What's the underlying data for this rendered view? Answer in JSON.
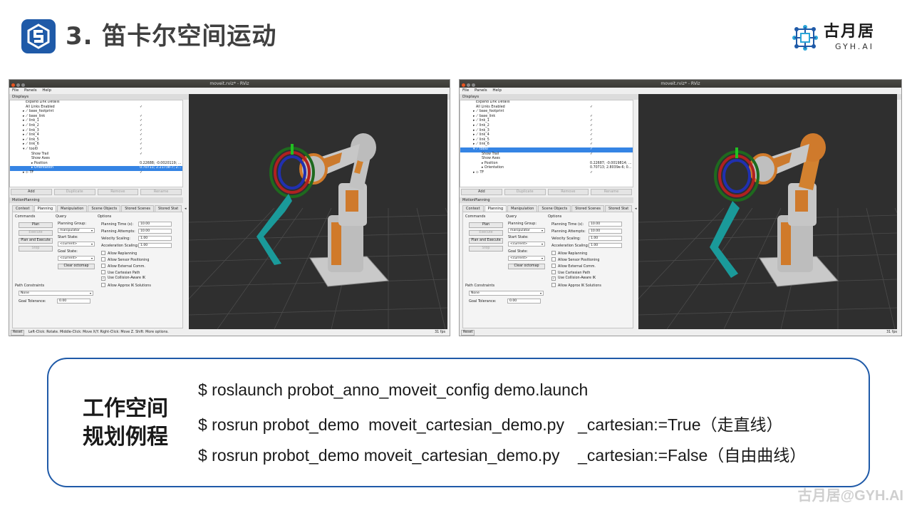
{
  "slide": {
    "title": "3. 笛卡尔空间运动",
    "brand_name": "古月居",
    "brand_sub": "GYH.AI",
    "accent": "#1f5aa8",
    "watermark": "古月居@GYH.AI"
  },
  "rviz_left": {
    "window_title": "moveit.rviz* - RViz",
    "menu": [
      "File",
      "Panels",
      "Help"
    ],
    "displays_header": "Displays",
    "tree": [
      {
        "label": "Expand Link Details",
        "check": ""
      },
      {
        "label": "All Links Enabled",
        "check": "✓"
      },
      {
        "label": "▸ ⟋ base_footprint",
        "check": ""
      },
      {
        "label": "▸ ⟋ base_link",
        "check": "✓"
      },
      {
        "label": "▸ ⟋ link_1",
        "check": "✓"
      },
      {
        "label": "▸ ⟋ link_2",
        "check": "✓"
      },
      {
        "label": "▸ ⟋ link_3",
        "check": "✓"
      },
      {
        "label": "▸ ⟋ link_4",
        "check": "✓"
      },
      {
        "label": "▸ ⟋ link_5",
        "check": "✓"
      },
      {
        "label": "▸ ⟋ link_6",
        "check": "✓"
      },
      {
        "label": "▾ ⟋ tool0",
        "check": "✓"
      },
      {
        "label": "Show Trail",
        "check": "✓"
      },
      {
        "label": "Show Axes",
        "check": ""
      },
      {
        "label": "▸ Position",
        "check": "0.22688; -0.0020119; ..."
      },
      {
        "label": "▸ Orientation",
        "check": "0.70711; 2.2173e-7; 2..."
      },
      {
        "label": "▸ ⊹ TF",
        "check": "✓"
      }
    ],
    "selected_row": 14,
    "status": "Left-Click: Rotate. Middle-Click: Move X/Y. Right-Click: Move Z. Shift: More options.",
    "fps": "31 fps"
  },
  "rviz_right": {
    "window_title": "moveit.rviz* - RViz",
    "menu": [
      "File",
      "Panels",
      "Help"
    ],
    "displays_header": "Displays",
    "tree": [
      {
        "label": "Expand Link Details",
        "check": ""
      },
      {
        "label": "All Links Enabled",
        "check": "✓"
      },
      {
        "label": "▸ ⟋ base_footprint",
        "check": ""
      },
      {
        "label": "▸ ⟋ base_link",
        "check": "✓"
      },
      {
        "label": "▸ ⟋ link_1",
        "check": "✓"
      },
      {
        "label": "▸ ⟋ link_2",
        "check": "✓"
      },
      {
        "label": "▸ ⟋ link_3",
        "check": "✓"
      },
      {
        "label": "▸ ⟋ link_4",
        "check": "✓"
      },
      {
        "label": "▸ ⟋ link_5",
        "check": "✓"
      },
      {
        "label": "▸ ⟋ link_6",
        "check": "✓"
      },
      {
        "label": "▾ ⟋ tool0",
        "check": "✓"
      },
      {
        "label": "Show Trail",
        "check": "✓"
      },
      {
        "label": "Show Axes",
        "check": ""
      },
      {
        "label": "▸ Position",
        "check": "0.22687; -0.0019814; ..."
      },
      {
        "label": "▸ Orientation",
        "check": "0.70713; 2.8039e-6; 0..."
      },
      {
        "label": "▸ ⊹ TF",
        "check": "✓"
      }
    ],
    "selected_row": 10,
    "status": "",
    "fps": "31 fps"
  },
  "buttons": {
    "add": "Add",
    "duplicate": "Duplicate",
    "remove": "Remove",
    "rename": "Rename"
  },
  "motion_planning": {
    "header": "MotionPlanning",
    "tabs": [
      "Context",
      "Planning",
      "Manipulation",
      "Scene Objects",
      "Stored Scenes",
      "Stored Stat"
    ],
    "commands": "Commands",
    "query": "Query",
    "options": "Options",
    "plan": "Plan",
    "execute": "Execute",
    "plan_execute": "Plan and Execute",
    "stop": "Stop",
    "planning_group_label": "Planning Group:",
    "planning_group": "manipulator",
    "start_state_label": "Start State:",
    "start_state": "<current>",
    "goal_state_label": "Goal State:",
    "goal_state": "<current>",
    "clear_octomap": "Clear octomap",
    "planning_time_label": "Planning Time (s):",
    "planning_time": "10.00",
    "planning_attempts_label": "Planning Attempts:",
    "planning_attempts": "10.00",
    "velocity_label": "Velocity Scaling:",
    "velocity": "1.00",
    "accel_label": "Acceleration Scaling:",
    "accel": "1.00",
    "checks": [
      {
        "label": "Allow Replanning",
        "on": false
      },
      {
        "label": "Allow Sensor Positioning",
        "on": false
      },
      {
        "label": "Allow External Comm.",
        "on": false
      },
      {
        "label": "Use Cartesian Path",
        "on": false
      },
      {
        "label": "Use Collision-Aware IK",
        "on": true
      },
      {
        "label": "Allow Approx IK Solutions",
        "on": false
      }
    ],
    "path_constraints": "Path Constraints",
    "path_constraint_value": "None",
    "goal_tolerance_label": "Goal Tolerance:",
    "goal_tolerance": "0.00",
    "reset": "Reset"
  },
  "commands_box": {
    "title": "工作空间 规划例程",
    "lines": [
      "$ roslaunch probot_anno_moveit_config demo.launch",
      "$ rosrun probot_demo  moveit_cartesian_demo.py   _cartesian:=True（走直线）",
      "$ rosrun probot_demo moveit_cartesian_demo.py    _cartesian:=False（自由曲线）"
    ]
  }
}
